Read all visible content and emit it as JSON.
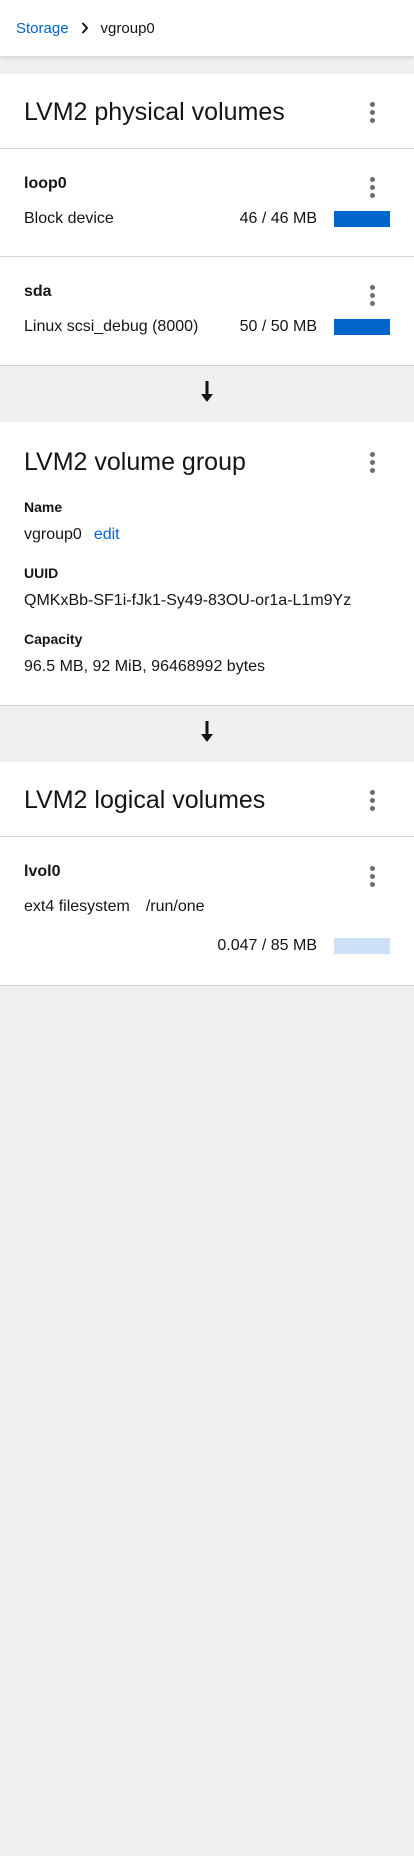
{
  "breadcrumb": {
    "root": "Storage",
    "current": "vgroup0"
  },
  "physical_volumes": {
    "title": "LVM2 physical volumes",
    "items": [
      {
        "name": "loop0",
        "description": "Block device",
        "size": "46 / 46 MB",
        "usage_fraction": 1.0
      },
      {
        "name": "sda",
        "description": "Linux scsi_debug (8000)",
        "size": "50 / 50 MB",
        "usage_fraction": 1.0
      }
    ]
  },
  "volume_group": {
    "title": "LVM2 volume group",
    "name_label": "Name",
    "name_value": "vgroup0",
    "edit_label": "edit",
    "uuid_label": "UUID",
    "uuid_value": "QMKxBb-SF1i-fJk1-Sy49-83OU-or1a-L1m9Yz",
    "capacity_label": "Capacity",
    "capacity_value": "96.5 MB, 92 MiB, 96468992 bytes"
  },
  "logical_volumes": {
    "title": "LVM2 logical volumes",
    "items": [
      {
        "name": "lvol0",
        "filesystem": "ext4 filesystem",
        "mountpoint": "/run/one",
        "size": "0.047 / 85 MB",
        "usage_fraction": 0.0006
      }
    ]
  },
  "icons": {
    "breadcrumb_separator": "chevron-right-icon",
    "flow_arrow": "arrow-down-icon",
    "menu": "kebab-icon"
  },
  "colors": {
    "link": "#0066cc",
    "bar_fill": "#0066cc",
    "bar_track": "#cce1f6"
  }
}
